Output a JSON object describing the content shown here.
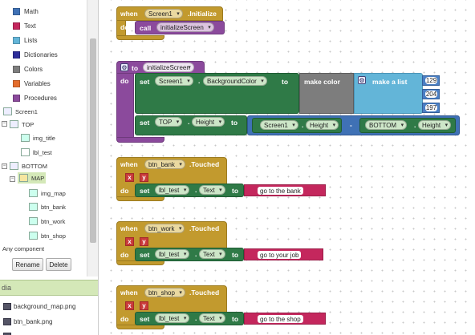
{
  "palette": {
    "builtin_items": [
      {
        "label": "Math",
        "color": "#3f71b5"
      },
      {
        "label": "Text",
        "color": "#c4275d"
      },
      {
        "label": "Lists",
        "color": "#63b5d8"
      },
      {
        "label": "Dictionaries",
        "color": "#2d2d9a"
      },
      {
        "label": "Colors",
        "color": "#7d7d7d"
      },
      {
        "label": "Variables",
        "color": "#e46d2c"
      },
      {
        "label": "Procedures",
        "color": "#8b4a9c"
      }
    ],
    "components": [
      {
        "label": "Screen1"
      },
      {
        "label": "TOP"
      },
      {
        "label": "img_title"
      },
      {
        "label": "lbl_test"
      },
      {
        "label": "BOTTOM"
      },
      {
        "label": "MAP"
      },
      {
        "label": "img_map"
      },
      {
        "label": "btn_bank"
      },
      {
        "label": "btn_work"
      },
      {
        "label": "btn_shop"
      },
      {
        "label": "Any component"
      }
    ],
    "rename_label": "Rename",
    "delete_label": "Delete",
    "media_title": "dia",
    "media_items": [
      "background_map.png",
      "btn_bank.png"
    ]
  },
  "blocks": {
    "init": {
      "when": "when",
      "component": "Screen1",
      "event": ".Initialize",
      "do": "do",
      "call": "call",
      "proc": "initializeScreen"
    },
    "proc": {
      "to": "to",
      "name": "initializeScreen",
      "do": "do",
      "set1": {
        "set": "set",
        "component": "Screen1",
        "prop": "BackgroundColor",
        "to": "to",
        "make_color": "make color",
        "make_list": "make a list",
        "values": [
          "129",
          "204",
          "197"
        ]
      },
      "set2": {
        "set": "set",
        "component": "TOP",
        "prop": "Height",
        "to": "to",
        "left_comp": "Screen1",
        "left_prop": "Height",
        "op": "-",
        "right_comp": "BOTTOM",
        "right_prop": "Height"
      }
    },
    "events": [
      {
        "when": "when",
        "component": "btn_bank",
        "event": ".Touched",
        "p1": "x",
        "p2": "y",
        "do": "do",
        "set": "set",
        "target": "lbl_test",
        "prop": "Text",
        "to": "to",
        "value": "go to the bank"
      },
      {
        "when": "when",
        "component": "btn_work",
        "event": ".Touched",
        "p1": "x",
        "p2": "y",
        "do": "do",
        "set": "set",
        "target": "lbl_test",
        "prop": "Text",
        "to": "to",
        "value": "go to your job"
      },
      {
        "when": "when",
        "component": "btn_shop",
        "event": ".Touched",
        "p1": "x",
        "p2": "y",
        "do": "do",
        "set": "set",
        "target": "lbl_test",
        "prop": "Text",
        "to": "to",
        "value": "go to the shop"
      }
    ]
  }
}
